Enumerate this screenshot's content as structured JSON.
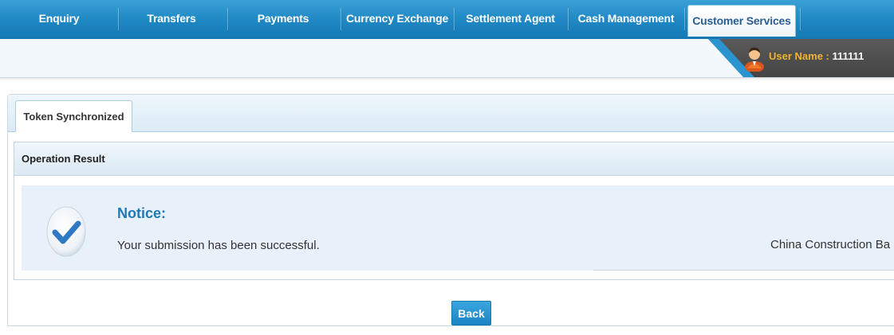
{
  "nav": {
    "tabs": [
      {
        "label": "Enquiry"
      },
      {
        "label": "Transfers"
      },
      {
        "label": "Payments"
      },
      {
        "label": "Currency Exchange"
      },
      {
        "label": "Settlement Agent"
      },
      {
        "label": "Cash Management"
      },
      {
        "label": "Customer Services",
        "active": true
      }
    ]
  },
  "user": {
    "label": "User Name : ",
    "value": "111111",
    "icon": "user-avatar-icon"
  },
  "page_tab": {
    "label": "Token Synchronized"
  },
  "result": {
    "title": "Operation Result",
    "notice_title": "Notice:",
    "message": "Your submission has been successful.",
    "bank": "China Construction Ba",
    "icon": "checkmark-icon"
  },
  "actions": {
    "back_label": "Back"
  },
  "colors": {
    "nav_blue": "#1f88c4",
    "notice_title": "#1e78b6",
    "user_label": "#f2b231",
    "notice_bg": "#e8f1fa"
  }
}
